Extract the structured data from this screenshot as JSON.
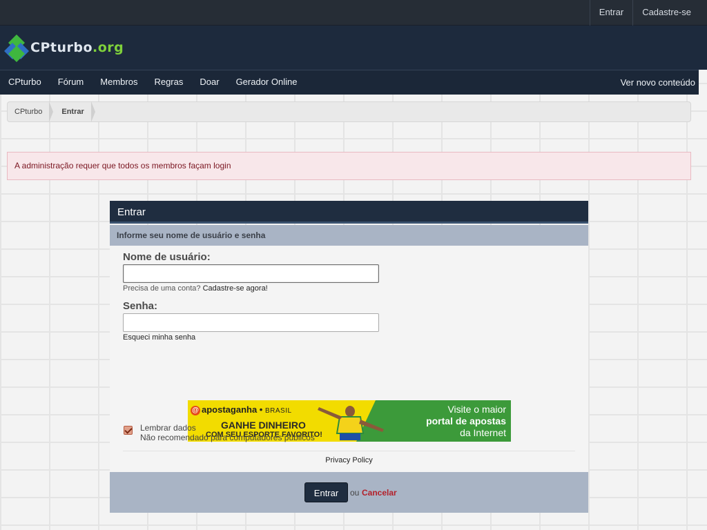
{
  "topbar": {
    "login": "Entrar",
    "register": "Cadastre-se"
  },
  "logo": {
    "part1": "CPturbo",
    "part2": ".org"
  },
  "nav": {
    "items": [
      "CPturbo",
      "Fórum",
      "Membros",
      "Regras",
      "Doar",
      "Gerador Online"
    ],
    "right": "Ver novo conteúdo"
  },
  "breadcrumb": {
    "home": "CPturbo",
    "current": "Entrar"
  },
  "alert": {
    "message": "A administração requer que todos os membros façam login"
  },
  "login_panel": {
    "title": "Entrar",
    "subtitle": "Informe seu nome de usuário e senha",
    "username_label": "Nome de usuário:",
    "username_value": "",
    "need_account": "Precisa de uma conta?",
    "register_now": "Cadastre-se agora!",
    "password_label": "Senha:",
    "password_value": "",
    "forgot_password": "Esqueci minha senha",
    "remember_label": "Lembrar dados",
    "remember_hint": "Não recomendado para computadores públicos",
    "remember_checked": true,
    "privacy": "Privacy Policy",
    "submit": "Entrar",
    "or": "ou",
    "cancel": "Cancelar"
  },
  "ad": {
    "brand": "apostaganha",
    "brand_suffix": "BRASIL",
    "headline": "GANHE DINHEIRO",
    "tagline": "COM SEU ESPORTE FAVORITO!",
    "right_line1": "Visite o maior",
    "right_line2": "portal de apostas",
    "right_line3": "da Internet"
  }
}
